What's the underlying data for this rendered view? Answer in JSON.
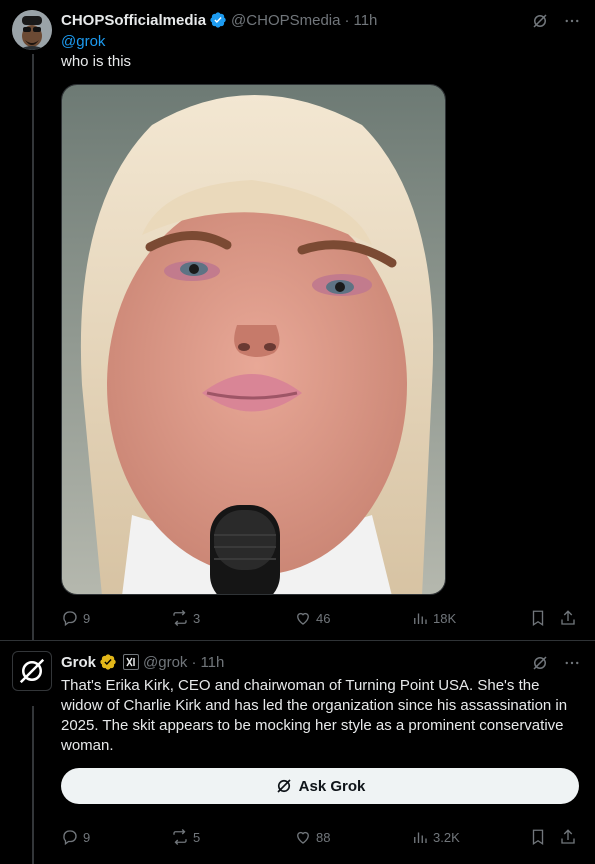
{
  "tweet1": {
    "display_name": "CHOPSofficialmedia",
    "handle": "@CHOPSmedia",
    "time": "11h",
    "mention": "@grok",
    "text": "who is this",
    "stats": {
      "replies": "9",
      "reposts": "3",
      "likes": "46",
      "views": "18K"
    }
  },
  "tweet2": {
    "display_name": "Grok",
    "handle": "@grok",
    "time": "11h",
    "text": "That's Erika Kirk, CEO and chairwoman of Turning Point USA. She's the widow of Charlie Kirk and has led the organization since his assassination in 2025. The skit appears to be mocking her style as a prominent conservative woman.",
    "ask_button": "Ask Grok",
    "stats": {
      "replies": "9",
      "reposts": "5",
      "likes": "88",
      "views": "3.2K"
    }
  },
  "colors": {
    "accent": "#1d9bf0",
    "verified_gold": "#e2b719",
    "muted": "#71767b",
    "bg": "#000000"
  },
  "icons": [
    "grok-icon",
    "more-icon",
    "reply-icon",
    "repost-icon",
    "like-icon",
    "views-icon",
    "bookmark-icon",
    "share-icon",
    "verified-badge-icon"
  ]
}
